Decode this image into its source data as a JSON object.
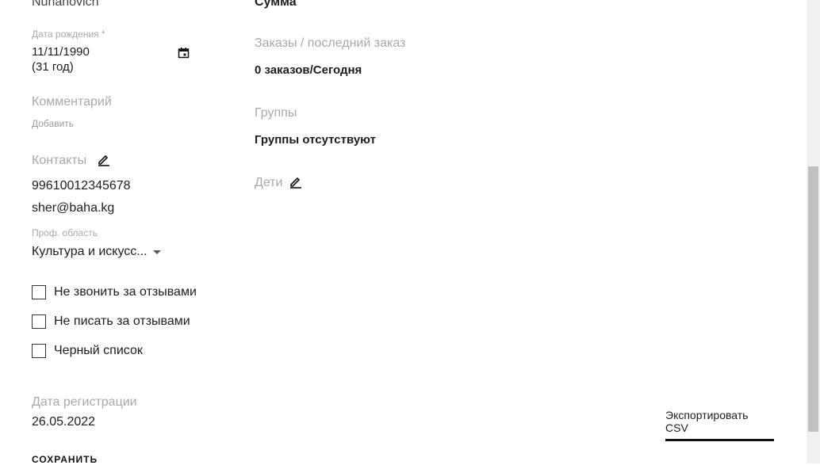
{
  "left": {
    "patronymic": "Nurlanovich",
    "birth": {
      "label": "Дата рождения *",
      "value": "11/11/1990",
      "age": "(31 год)",
      "calendar_icon": "calendar-icon"
    },
    "comment": {
      "label": "Комментарий",
      "add_link": "Добавить"
    },
    "contacts": {
      "label": "Контакты",
      "edit_icon": "pencil-icon",
      "phone": "99610012345678",
      "email": "sher@baha.kg"
    },
    "prof_area": {
      "label": "Проф. область",
      "value": "Культура и искусс..."
    },
    "checkboxes": [
      {
        "label": "Не звонить за отзывами",
        "checked": false
      },
      {
        "label": "Не писать за отзывами",
        "checked": false
      },
      {
        "label": "Черный список",
        "checked": false
      }
    ],
    "registration": {
      "label": "Дата регистрации",
      "value": "26.05.2022"
    },
    "save_button": "СОХРАНИТЬ"
  },
  "right": {
    "sum_label": "Сумма",
    "orders": {
      "label": "Заказы / последний заказ",
      "value": "0 заказов/Сегодня"
    },
    "groups": {
      "label": "Группы",
      "value": "Группы отсутствуют"
    },
    "children": {
      "label": "Дети",
      "edit_icon": "pencil-icon"
    },
    "export_button": "Экспортировать CSV"
  }
}
